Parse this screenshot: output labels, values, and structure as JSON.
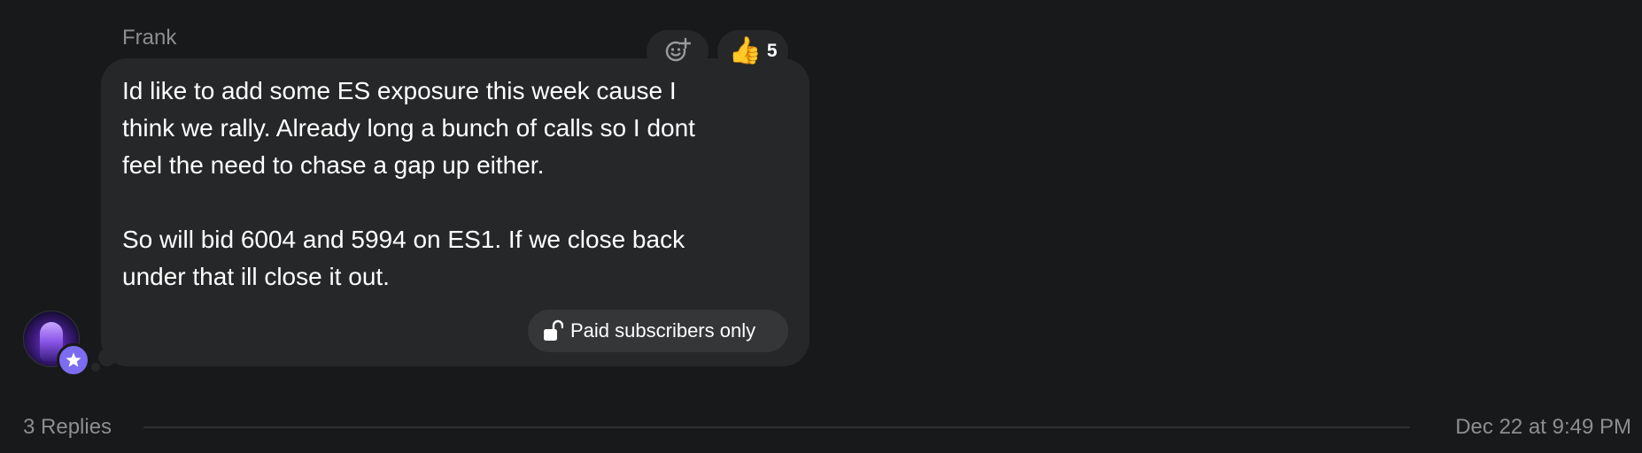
{
  "message": {
    "sender": "Frank",
    "text": "Id like to add some ES exposure this week cause I\nthink we rally. Already long a bunch of calls so I dont\nfeel the need to chase a gap up either.\n\nSo will bid 6004 and 5994 on ES1. If we close back\nunder that ill close it out.",
    "badge_label": "Paid subscribers only",
    "badge_icon": "unlock-icon",
    "reaction": {
      "emoji": "👍",
      "count": "5"
    },
    "add_reaction_icon": "add-reaction-icon"
  },
  "thread": {
    "replies_label": "3 Replies",
    "timestamp": "Dec 22 at 9:49 PM"
  },
  "colors": {
    "background": "#18191b",
    "bubble": "#262728",
    "muted_text": "#8d8e90",
    "badge_accent": "#7b6cf0"
  }
}
